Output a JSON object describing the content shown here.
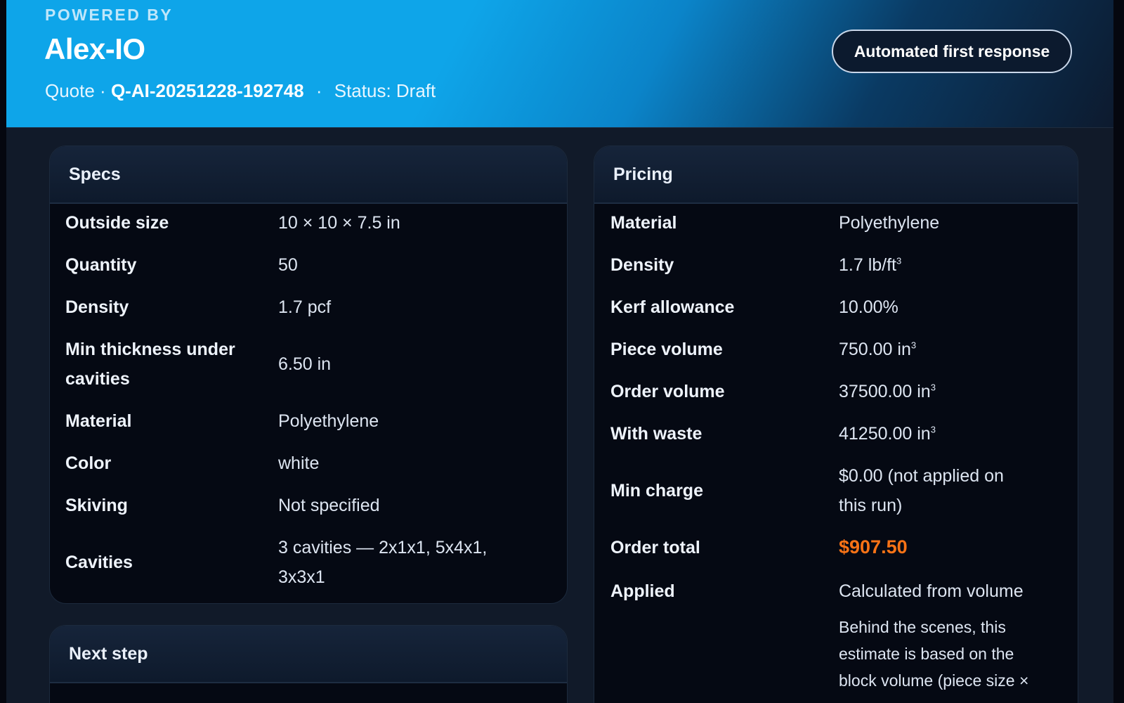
{
  "header": {
    "powered_by": "POWERED BY",
    "brand": "Alex-IO",
    "quote_label": "Quote ·",
    "quote_number": "Q-AI-20251228-192748",
    "separator": "·",
    "status": "Status: Draft",
    "badge": "Automated first response"
  },
  "specs": {
    "title": "Specs",
    "rows": [
      {
        "label": "Outside size",
        "value": "10 × 10 × 7.5 in"
      },
      {
        "label": "Quantity",
        "value": "50"
      },
      {
        "label": "Density",
        "value": "1.7 pcf"
      },
      {
        "label": "Min thickness under",
        "label2": "cavities",
        "value": "6.50 in"
      },
      {
        "label": "Material",
        "value": "Polyethylene"
      },
      {
        "label": "Color",
        "value": "white"
      },
      {
        "label": "Skiving",
        "value": "Not specified"
      },
      {
        "label": "Cavities",
        "value": "3 cavities — 2x1x1, 5x4x1,",
        "value2": "3x3x1"
      }
    ]
  },
  "next_step": {
    "title": "Next step"
  },
  "pricing": {
    "title": "Pricing",
    "rows": [
      {
        "label": "Material",
        "value": "Polyethylene"
      },
      {
        "label": "Density",
        "value": "1.7 lb/ft",
        "sup": "3"
      },
      {
        "label": "Kerf allowance",
        "value": "10.00%"
      },
      {
        "label": "Piece volume",
        "value": "750.00 in",
        "sup": "3"
      },
      {
        "label": "Order volume",
        "value": "37500.00 in",
        "sup": "3"
      },
      {
        "label": "With waste",
        "value": "41250.00 in",
        "sup": "3"
      },
      {
        "label": "Min charge",
        "value": "$0.00 (not applied on",
        "value2": "this run)"
      },
      {
        "label": "Order total",
        "value": "$907.50"
      },
      {
        "label": "Applied",
        "value": "Calculated from volume"
      }
    ],
    "note_lines": [
      "Behind the scenes, this",
      "estimate is based on the",
      "block volume (piece size ×"
    ]
  },
  "colors": {
    "accent": "#0ea5e9",
    "total": "#f97316",
    "background": "#111a29",
    "card": "#050913"
  }
}
